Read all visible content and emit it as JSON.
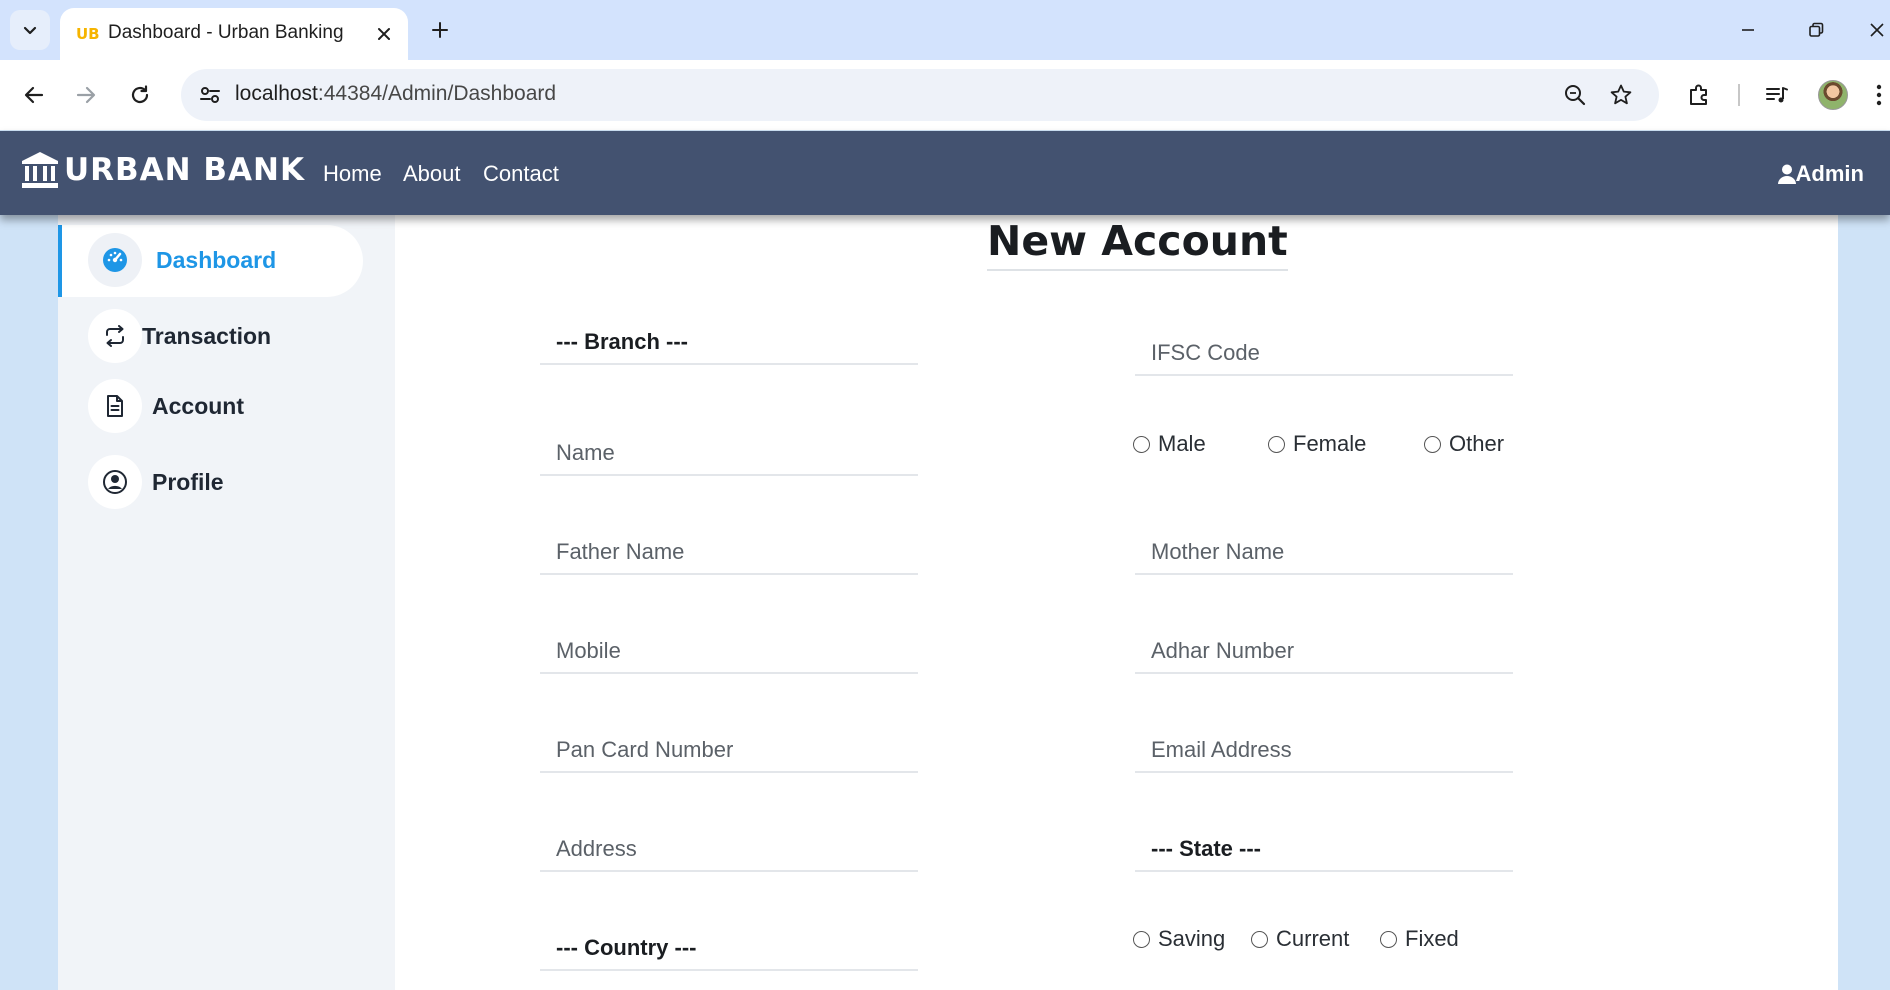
{
  "browser": {
    "tab_title": "Dashboard - Urban Banking",
    "favicon_text": "UB",
    "url_host": "localhost",
    "url_path": ":44384/Admin/Dashboard"
  },
  "navbar": {
    "brand": "URBAN BANK",
    "links": [
      "Home",
      "About",
      "Contact"
    ],
    "user": "Admin"
  },
  "sidebar": {
    "items": [
      {
        "label": "Dashboard",
        "icon": "dashboard-gauge-icon",
        "active": true
      },
      {
        "label": "Transaction",
        "icon": "repeat-icon",
        "active": false
      },
      {
        "label": "Account",
        "icon": "document-icon",
        "active": false
      },
      {
        "label": "Profile",
        "icon": "user-circle-icon",
        "active": false
      }
    ]
  },
  "form": {
    "title": "New Account",
    "branch": "--- Branch ---",
    "ifsc": "IFSC Code",
    "name": "Name",
    "gender_options": [
      "Male",
      "Female",
      "Other"
    ],
    "father_name": "Father Name",
    "mother_name": "Mother Name",
    "mobile": "Mobile",
    "adhar": "Adhar Number",
    "pan": "Pan Card Number",
    "email": "Email Address",
    "address": "Address",
    "state": "--- State ---",
    "country": "--- Country ---",
    "account_type_options": [
      "Saving",
      "Current",
      "Fixed"
    ]
  },
  "colors": {
    "navbar": "#435270",
    "accent": "#1e96e6",
    "sidebar_bg": "#f1f4f8",
    "page_bg": "#cfe3f7"
  }
}
